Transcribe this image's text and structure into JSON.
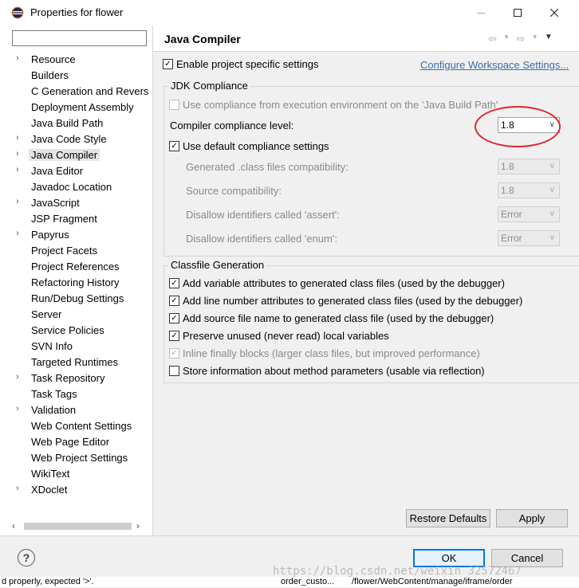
{
  "window": {
    "title": "Properties for flower"
  },
  "sidebar": {
    "filter_placeholder": "",
    "items": [
      {
        "label": "Resource",
        "expandable": true
      },
      {
        "label": "Builders",
        "expandable": false
      },
      {
        "label": "C Generation and Revers",
        "expandable": false
      },
      {
        "label": "Deployment Assembly",
        "expandable": false
      },
      {
        "label": "Java Build Path",
        "expandable": false
      },
      {
        "label": "Java Code Style",
        "expandable": true
      },
      {
        "label": "Java Compiler",
        "expandable": true
      },
      {
        "label": "Java Editor",
        "expandable": true
      },
      {
        "label": "Javadoc Location",
        "expandable": false
      },
      {
        "label": "JavaScript",
        "expandable": true
      },
      {
        "label": "JSP Fragment",
        "expandable": false
      },
      {
        "label": "Papyrus",
        "expandable": true
      },
      {
        "label": "Project Facets",
        "expandable": false
      },
      {
        "label": "Project References",
        "expandable": false
      },
      {
        "label": "Refactoring History",
        "expandable": false
      },
      {
        "label": "Run/Debug Settings",
        "expandable": false
      },
      {
        "label": "Server",
        "expandable": false
      },
      {
        "label": "Service Policies",
        "expandable": false
      },
      {
        "label": "SVN Info",
        "expandable": false
      },
      {
        "label": "Targeted Runtimes",
        "expandable": false
      },
      {
        "label": "Task Repository",
        "expandable": true
      },
      {
        "label": "Task Tags",
        "expandable": false
      },
      {
        "label": "Validation",
        "expandable": true
      },
      {
        "label": "Web Content Settings",
        "expandable": false
      },
      {
        "label": "Web Page Editor",
        "expandable": false
      },
      {
        "label": "Web Project Settings",
        "expandable": false
      },
      {
        "label": "WikiText",
        "expandable": false
      },
      {
        "label": "XDoclet",
        "expandable": true
      }
    ],
    "selected": "Java Compiler"
  },
  "page": {
    "title": "Java Compiler",
    "enable_specific": {
      "label": "Enable project specific settings",
      "checked": true
    },
    "configure_link": "Configure Workspace Settings...",
    "jdk_group": {
      "title": "JDK Compliance",
      "use_compliance_env": {
        "label": "Use compliance from execution environment on the 'Java Build Path'",
        "checked": false,
        "enabled": false
      },
      "compliance_level": {
        "label": "Compiler compliance level:",
        "value": "1.8"
      },
      "use_default": {
        "label": "Use default compliance settings",
        "checked": true
      },
      "generated_class": {
        "label": "Generated .class files compatibility:",
        "value": "1.8"
      },
      "source_compat": {
        "label": "Source compatibility:",
        "value": "1.8"
      },
      "disallow_assert": {
        "label": "Disallow identifiers called 'assert':",
        "value": "Error"
      },
      "disallow_enum": {
        "label": "Disallow identifiers called 'enum':",
        "value": "Error"
      }
    },
    "classfile_group": {
      "title": "Classfile Generation",
      "options": [
        {
          "label": "Add variable attributes to generated class files (used by the debugger)",
          "checked": true,
          "enabled": true
        },
        {
          "label": "Add line number attributes to generated class files (used by the debugger)",
          "checked": true,
          "enabled": true
        },
        {
          "label": "Add source file name to generated class file (used by the debugger)",
          "checked": true,
          "enabled": true
        },
        {
          "label": "Preserve unused (never read) local variables",
          "checked": true,
          "enabled": true
        },
        {
          "label": "Inline finally blocks (larger class files, but improved performance)",
          "checked": true,
          "enabled": false
        },
        {
          "label": "Store information about method parameters (usable via reflection)",
          "checked": false,
          "enabled": true
        }
      ]
    },
    "restore_defaults": "Restore Defaults",
    "apply": "Apply"
  },
  "footer": {
    "ok": "OK",
    "cancel": "Cancel",
    "help_glyph": "?",
    "watermark": "https://blog.csdn.net/weixin_32572467"
  },
  "background": {
    "left_text": "d properly, expected '>'.",
    "mid_text": "order_custo...",
    "right_text": "/flower/WebContent/manage/iframe/order"
  },
  "icons": {
    "app": "eclipse-icon",
    "chevron": "chevron-right-icon",
    "dropdown": "chevron-down-icon"
  }
}
